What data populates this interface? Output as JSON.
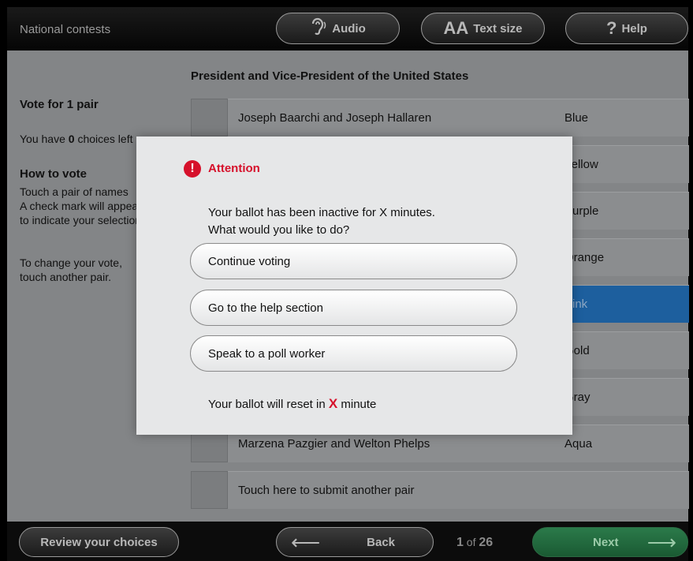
{
  "topbar": {
    "section_title": "National contests",
    "audio_label": "Audio",
    "audio_icon": "ear-audio-icon",
    "textsize_glyph": "AA",
    "textsize_label": "Text size",
    "help_glyph": "?",
    "help_label": "Help"
  },
  "contest": {
    "title": "President and Vice-President of the United States"
  },
  "sidebar": {
    "vote_for": "Vote for 1 pair",
    "choices_prefix": "You have ",
    "choices_count": "0",
    "choices_suffix": " choices left",
    "howto_title": "How to vote",
    "instructions": "Touch a pair of names\nA check mark will appear\nto indicate your selection",
    "change": "To change your vote,\ntouch another pair."
  },
  "candidates": [
    {
      "name": "Joseph Baarchi and Joseph Hallaren",
      "party": "Blue"
    },
    {
      "name": "",
      "party": "Yellow"
    },
    {
      "name": "",
      "party": "Purple"
    },
    {
      "name": "",
      "party": "Orange"
    },
    {
      "name": "",
      "party": "Pink",
      "selected": true
    },
    {
      "name": "",
      "party": "Gold"
    },
    {
      "name": "",
      "party": "Gray"
    },
    {
      "name": "Marzena Pazgier and Welton Phelps",
      "party": "Aqua"
    }
  ],
  "write_in": {
    "label": "Touch here to submit another pair"
  },
  "bottombar": {
    "review_label": "Review your choices",
    "back_label": "Back",
    "page_current": "1",
    "page_of": " of ",
    "page_total": "26",
    "next_label": "Next"
  },
  "modal": {
    "title": "Attention",
    "message_line1": "Your ballot has been inactive for X minutes.",
    "message_line2": "What would you like to do?",
    "btn_continue": "Continue voting",
    "btn_help": "Go to the help section",
    "btn_poll": "Speak to a poll worker",
    "reset_prefix": "Your ballot will reset in ",
    "reset_x": "X",
    "reset_suffix": " minute"
  },
  "colors": {
    "attention_red": "#d6112b",
    "selected_blue": "#1d5f9e",
    "next_green": "#2b7a4a"
  }
}
